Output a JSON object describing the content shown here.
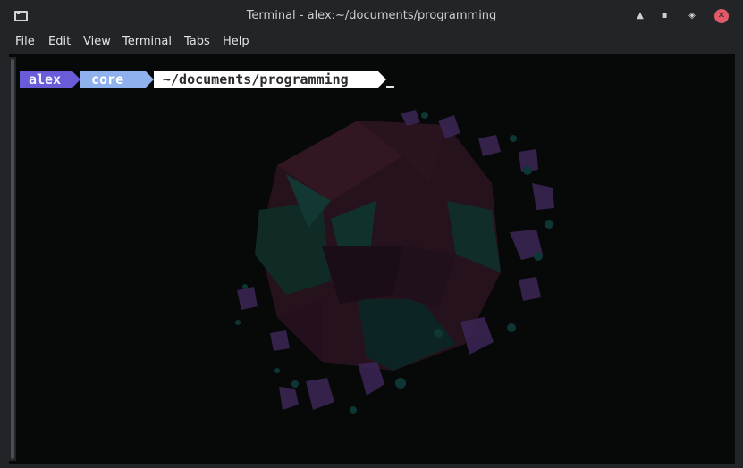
{
  "window": {
    "title": "Terminal - alex:~/documents/programming"
  },
  "menu": [
    "File",
    "Edit",
    "View",
    "Terminal",
    "Tabs",
    "Help"
  ],
  "prompt": {
    "user": "alex",
    "host": "core",
    "path": "~/documents/programming",
    "cursor": "_"
  },
  "colors": {
    "user_bg": "#6a5bd8",
    "host_bg": "#8fb2ee",
    "path_bg": "#ffffff",
    "close_button": "#e05a67"
  },
  "icons": {
    "app": "terminal-icon",
    "up": "eject-icon",
    "minimize": "minimize-icon",
    "maximize": "maximize-icon",
    "close": "close-icon"
  }
}
